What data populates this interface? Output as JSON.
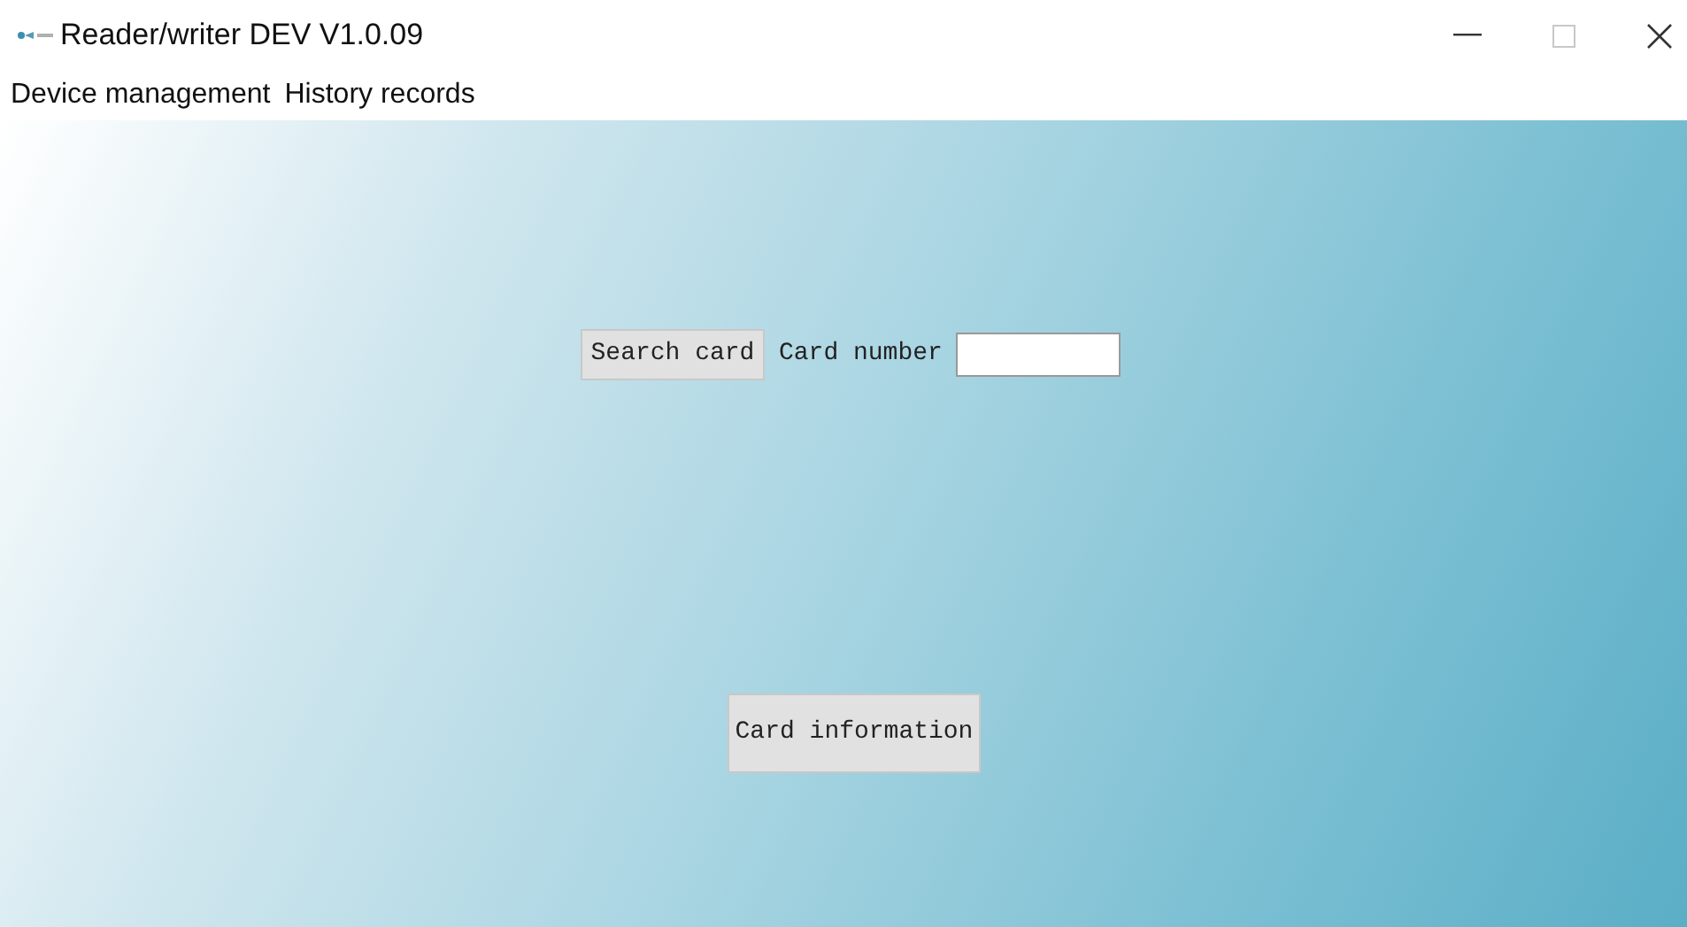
{
  "window": {
    "title": "Reader/writer DEV V1.0.09"
  },
  "menu": [
    "Device management",
    "History records"
  ],
  "search_button": "Search card",
  "card_number": {
    "label": "Card number"
  },
  "info_button": "Card information"
}
